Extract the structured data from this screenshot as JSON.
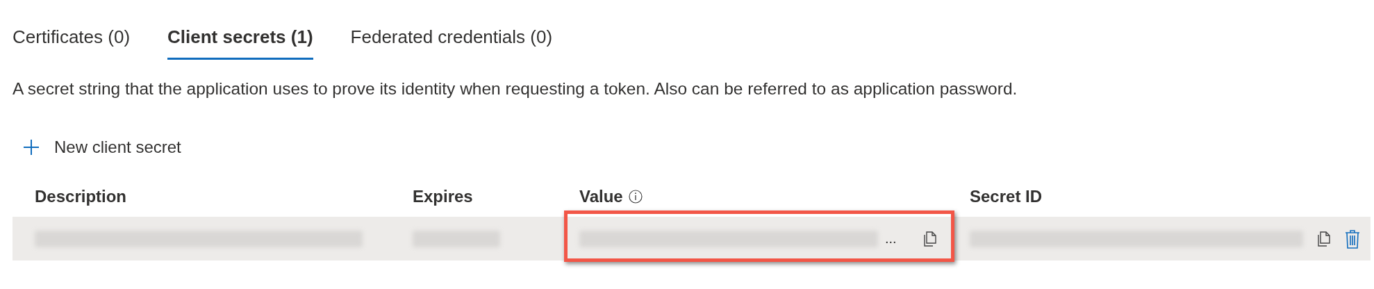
{
  "tabs": [
    {
      "label": "Certificates (0)",
      "selected": false
    },
    {
      "label": "Client secrets (1)",
      "selected": true
    },
    {
      "label": "Federated credentials (0)",
      "selected": false
    }
  ],
  "description": "A secret string that the application uses to prove its identity when requesting a token. Also can be referred to as application password.",
  "new_button": "New client secret",
  "table": {
    "columns": [
      "Description",
      "Expires",
      "Value",
      "Secret ID"
    ],
    "rows": [
      {
        "value_ellipsis": "...",
        "value_highlighted": true
      }
    ]
  }
}
